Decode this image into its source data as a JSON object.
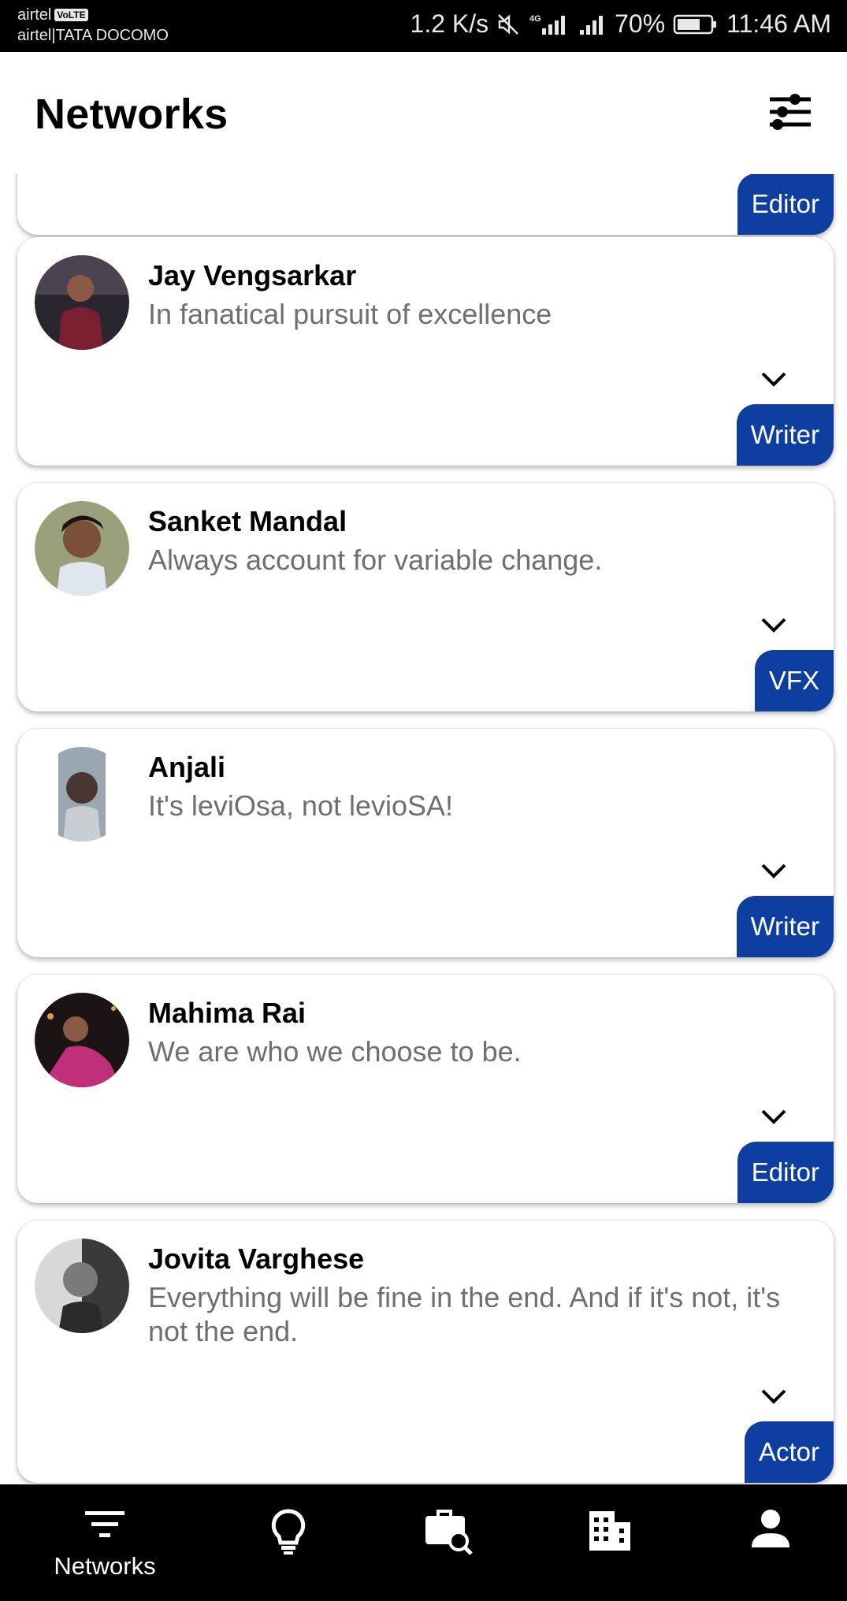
{
  "status_bar": {
    "carrier1": "airtel",
    "volte": "VoLTE",
    "carrier2": "airtel|TATA DOCOMO",
    "speed": "1.2 K/s",
    "network": "4G",
    "battery": "70%",
    "time": "11:46 AM"
  },
  "header": {
    "title": "Networks",
    "filter_icon": "sliders-icon"
  },
  "cards": [
    {
      "name": "",
      "bio": "",
      "role": "Editor"
    },
    {
      "name": "Jay Vengsarkar",
      "bio": "In fanatical pursuit of excellence",
      "role": "Writer"
    },
    {
      "name": "Sanket Mandal",
      "bio": "Always account for variable change.",
      "role": "VFX"
    },
    {
      "name": "Anjali",
      "bio": "It's leviOsa, not levioSA!",
      "role": "Writer"
    },
    {
      "name": "Mahima Rai",
      "bio": "We are who we choose to be.",
      "role": "Editor"
    },
    {
      "name": "Jovita Varghese",
      "bio": "Everything will be fine in the end. And if it's not, it's not the end.",
      "role": "Actor"
    }
  ],
  "bottom_nav": {
    "items": [
      {
        "label": "Networks",
        "icon": "filter-lines-icon",
        "active": true
      },
      {
        "label": "",
        "icon": "lightbulb-icon"
      },
      {
        "label": "",
        "icon": "briefcase-search-icon"
      },
      {
        "label": "",
        "icon": "building-icon"
      },
      {
        "label": "",
        "icon": "person-icon"
      }
    ]
  },
  "colors": {
    "accent": "#0d3ea0",
    "bio_text": "#6f6f6f",
    "nav_bg": "#000000"
  }
}
